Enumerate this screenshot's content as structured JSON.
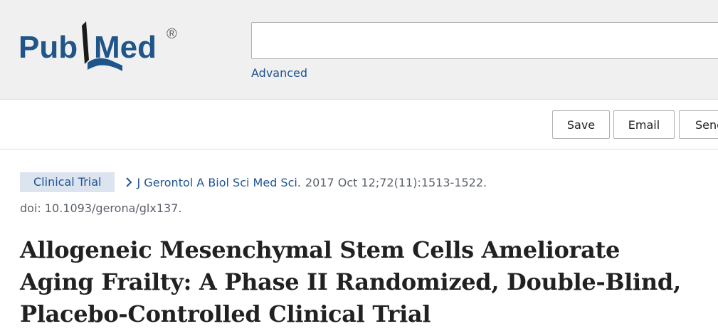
{
  "header": {
    "logo": {
      "text_pub": "Pub",
      "text_med": "Med",
      "registered_mark": "®",
      "icon": "pubmed-book-icon"
    },
    "search": {
      "value": "",
      "placeholder": ""
    },
    "advanced_link": "Advanced"
  },
  "actions": {
    "save_label": "Save",
    "email_label": "Email",
    "send_label": "Send to"
  },
  "article": {
    "publication_type": "Clinical Trial",
    "journal": "J Gerontol A Biol Sci Med Sci.",
    "citation": "2017 Oct 12;72(11):1513-1522.",
    "doi": "doi: 10.1093/gerona/glx137.",
    "title": "Allogeneic Mesenchymal Stem Cells Ameliorate Aging Frailty: A Phase II Randomized, Double-Blind, Placebo-Controlled Clinical Trial"
  },
  "colors": {
    "brand_blue": "#20558a",
    "link_blue": "#205493",
    "header_bg": "#f0f0f0",
    "badge_bg": "#dce4ef"
  }
}
